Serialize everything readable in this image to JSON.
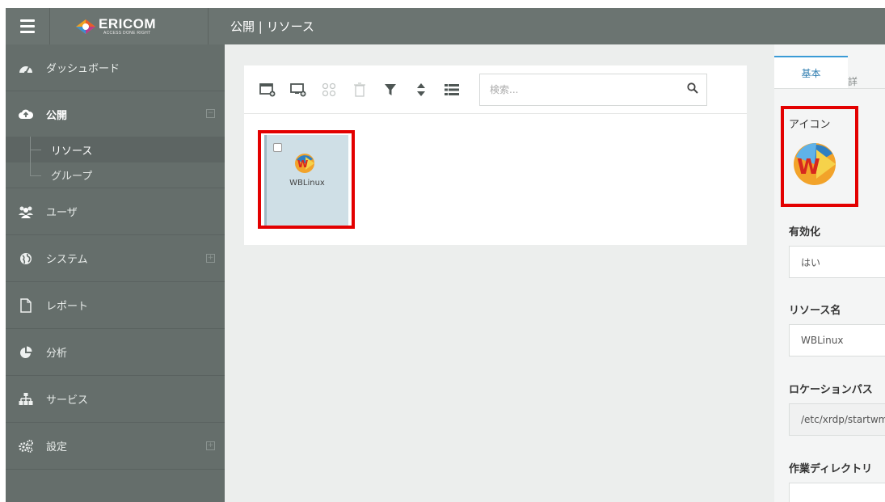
{
  "header": {
    "brand": "ERICOM",
    "tagline": "ACCESS DONE RIGHT",
    "page_title": "公開 | リソース"
  },
  "sidebar": {
    "items": [
      {
        "label": "ダッシュボード",
        "icon": "dashboard-icon"
      },
      {
        "label": "公開",
        "icon": "cloud-upload-icon",
        "expanded": true
      },
      {
        "label": "ユーザ",
        "icon": "users-icon"
      },
      {
        "label": "システム",
        "icon": "globe-icon",
        "expandable": true
      },
      {
        "label": "レポート",
        "icon": "document-icon"
      },
      {
        "label": "分析",
        "icon": "pie-chart-icon"
      },
      {
        "label": "サービス",
        "icon": "sitemap-icon"
      },
      {
        "label": "設定",
        "icon": "gears-icon",
        "expandable": true
      }
    ],
    "publish_children": [
      {
        "label": "リソース",
        "active": true
      },
      {
        "label": "グループ",
        "active": false
      }
    ]
  },
  "toolbar": {
    "search_placeholder": "検索..."
  },
  "resources": [
    {
      "name": "WBLinux",
      "icon": "wblinux-app-icon",
      "checked": false
    }
  ],
  "properties": {
    "tabs": [
      "基本",
      "詳"
    ],
    "icon_label": "アイコン",
    "enabled_label": "有効化",
    "enabled_value": "はい",
    "resource_name_label": "リソース名",
    "resource_name_value": "WBLinux",
    "location_label": "ロケーションパス",
    "location_value": "/etc/xrdp/startwm.sh",
    "workdir_label": "作業ディレクトリ",
    "workdir_value": ""
  },
  "colors": {
    "topbar": "#6b7471",
    "sidebar": "#656e6b",
    "highlight_box": "#e30000",
    "tile_bg": "#cfdfe6",
    "active_tab_accent": "#3b9bd6"
  }
}
